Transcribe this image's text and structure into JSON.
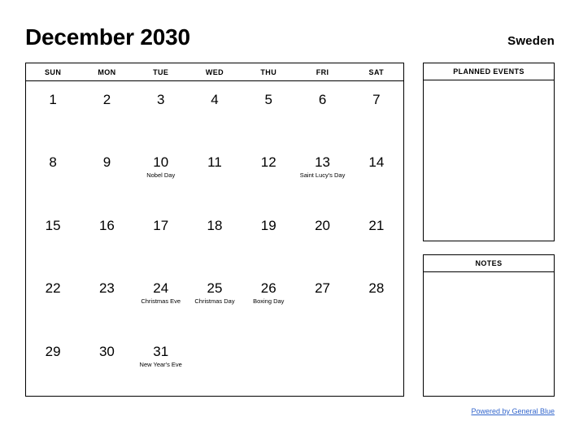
{
  "header": {
    "month_title": "December 2030",
    "country": "Sweden"
  },
  "calendar": {
    "weekday_headers": [
      "SUN",
      "MON",
      "TUE",
      "WED",
      "THU",
      "FRI",
      "SAT"
    ],
    "weeks": [
      [
        {
          "day": "1",
          "holiday": ""
        },
        {
          "day": "2",
          "holiday": ""
        },
        {
          "day": "3",
          "holiday": ""
        },
        {
          "day": "4",
          "holiday": ""
        },
        {
          "day": "5",
          "holiday": ""
        },
        {
          "day": "6",
          "holiday": ""
        },
        {
          "day": "7",
          "holiday": ""
        }
      ],
      [
        {
          "day": "8",
          "holiday": ""
        },
        {
          "day": "9",
          "holiday": ""
        },
        {
          "day": "10",
          "holiday": "Nobel Day"
        },
        {
          "day": "11",
          "holiday": ""
        },
        {
          "day": "12",
          "holiday": ""
        },
        {
          "day": "13",
          "holiday": "Saint Lucy's Day"
        },
        {
          "day": "14",
          "holiday": ""
        }
      ],
      [
        {
          "day": "15",
          "holiday": ""
        },
        {
          "day": "16",
          "holiday": ""
        },
        {
          "day": "17",
          "holiday": ""
        },
        {
          "day": "18",
          "holiday": ""
        },
        {
          "day": "19",
          "holiday": ""
        },
        {
          "day": "20",
          "holiday": ""
        },
        {
          "day": "21",
          "holiday": ""
        }
      ],
      [
        {
          "day": "22",
          "holiday": ""
        },
        {
          "day": "23",
          "holiday": ""
        },
        {
          "day": "24",
          "holiday": "Christmas Eve"
        },
        {
          "day": "25",
          "holiday": "Christmas Day"
        },
        {
          "day": "26",
          "holiday": "Boxing Day"
        },
        {
          "day": "27",
          "holiday": ""
        },
        {
          "day": "28",
          "holiday": ""
        }
      ],
      [
        {
          "day": "29",
          "holiday": ""
        },
        {
          "day": "30",
          "holiday": ""
        },
        {
          "day": "31",
          "holiday": "New Year's Eve"
        },
        {
          "day": "",
          "holiday": ""
        },
        {
          "day": "",
          "holiday": ""
        },
        {
          "day": "",
          "holiday": ""
        },
        {
          "day": "",
          "holiday": ""
        }
      ]
    ]
  },
  "sidebar": {
    "planned_events": {
      "title": "PLANNED EVENTS",
      "content": ""
    },
    "notes": {
      "title": "NOTES",
      "content": ""
    }
  },
  "footer": {
    "link_text": "Powered by General Blue"
  },
  "colors": {
    "link": "#3366cc",
    "border": "#000000",
    "background": "#ffffff",
    "text": "#000000"
  }
}
